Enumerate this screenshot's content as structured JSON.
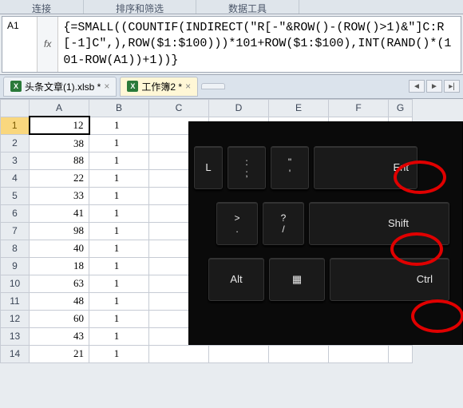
{
  "ribbon": {
    "group1": "连接",
    "group2": "排序和筛选",
    "group3": "数据工具"
  },
  "nameBox": "A1",
  "fx": "fx",
  "formula": "{=SMALL((COUNTIF(INDIRECT(\"R[-\"&ROW()-(ROW()>1)&\"]C:R[-1]C\",),ROW($1:$100)))*101+ROW($1:$100),INT(RAND()*(101-ROW(A1))+1))}",
  "tabs": {
    "file1": "头条文章(1).xlsb *",
    "file2": "工作簿2 *",
    "close": "×",
    "prev": "◄",
    "next": "►",
    "last": "▸|"
  },
  "cols": [
    "A",
    "B",
    "C",
    "D",
    "E",
    "F",
    "G"
  ],
  "rows": [
    {
      "n": 1,
      "a": 12,
      "b": 1
    },
    {
      "n": 2,
      "a": 38,
      "b": 1
    },
    {
      "n": 3,
      "a": 88,
      "b": 1
    },
    {
      "n": 4,
      "a": 22,
      "b": 1
    },
    {
      "n": 5,
      "a": 33,
      "b": 1
    },
    {
      "n": 6,
      "a": 41,
      "b": 1
    },
    {
      "n": 7,
      "a": 98,
      "b": 1
    },
    {
      "n": 8,
      "a": 40,
      "b": 1
    },
    {
      "n": 9,
      "a": 18,
      "b": 1
    },
    {
      "n": 10,
      "a": 63,
      "b": 1
    },
    {
      "n": 11,
      "a": 48,
      "b": 1
    },
    {
      "n": 12,
      "a": 60,
      "b": 1
    },
    {
      "n": 13,
      "a": 43,
      "b": 1
    },
    {
      "n": 14,
      "a": 21,
      "b": 1
    }
  ],
  "keys": {
    "L": "L",
    "semi_top": ":",
    "semi_bot": ";",
    "quote_top": "\"",
    "quote_bot": "'",
    "enter": "Ent",
    "gt_top": ">",
    "gt_bot": ".",
    "q_top": "?",
    "q_bot": "/",
    "shift": "Shift",
    "alt": "Alt",
    "menu": "▦",
    "ctrl": "Ctrl"
  }
}
